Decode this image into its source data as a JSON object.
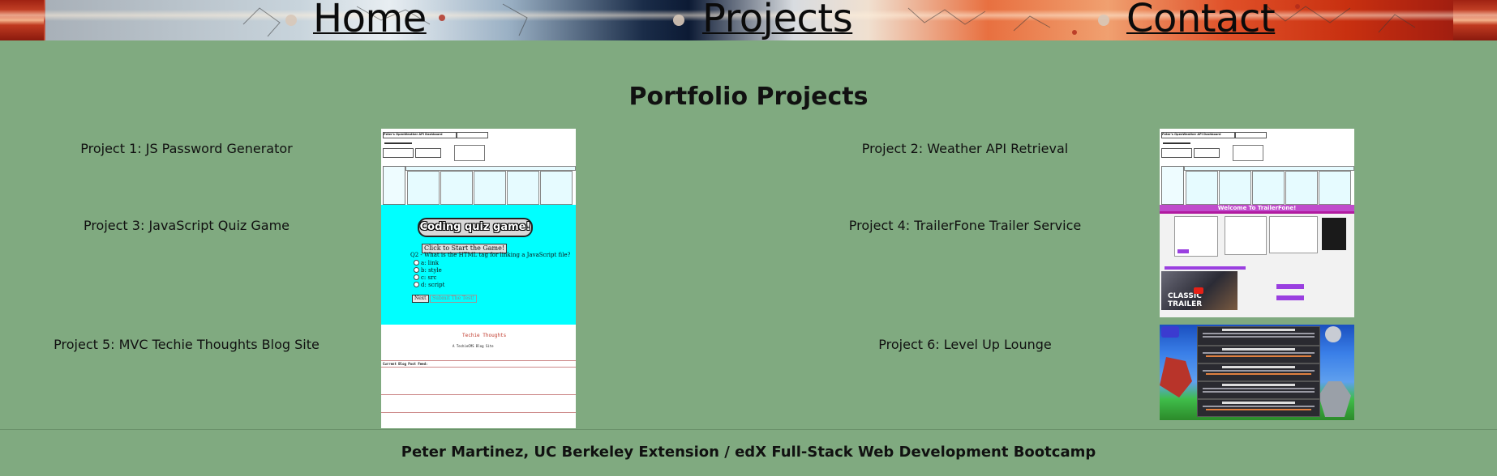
{
  "nav": {
    "home": "Home",
    "projects": "Projects",
    "contact": "Contact"
  },
  "page_title": "Portfolio Projects",
  "projects": [
    {
      "label": "Project 1: JS Password Generator"
    },
    {
      "label": "Project 2: Weather API Retrieval"
    },
    {
      "label": "Project 3: JavaScript Quiz Game"
    },
    {
      "label": "Project 4: TrailerFone Trailer Service"
    },
    {
      "label": "Project 5: MVC Techie Thoughts Blog Site"
    },
    {
      "label": "Project 6: Level Up Lounge"
    }
  ],
  "thumbs": {
    "weather_title": "Peter's OpenWeather API Dashboard",
    "quiz_title": "Coding quiz game!",
    "quiz_start": "Click to Start the Game!",
    "quiz_question": "Q2 - What is the HTML tag for linking a JavaScript file?",
    "quiz_options": [
      "a: link",
      "b: style",
      "c: src",
      "d: script"
    ],
    "quiz_next": "Next",
    "quiz_submit": "Submit The Test!",
    "trailer_banner": "Welcome To TrailerFone!",
    "trailer_video": "CLASSIC TRAILER",
    "blog_title": "Techie Thoughts",
    "blog_subtitle": "A TechieCMS Blog Site",
    "blog_section": "Current Blog Post Feed:"
  },
  "footer": "Peter Martinez, UC Berkeley Extension / edX Full-Stack Web Development Bootcamp"
}
